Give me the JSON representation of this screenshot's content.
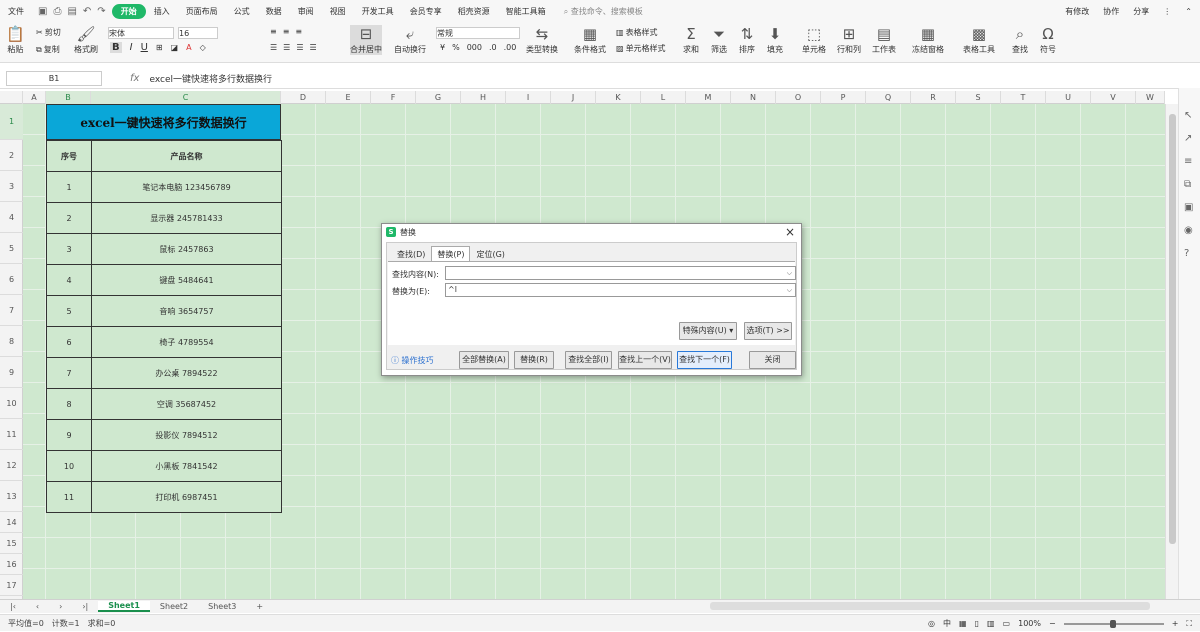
{
  "menubar": {
    "file": "文件",
    "tabs": [
      "开始",
      "插入",
      "页面布局",
      "公式",
      "数据",
      "审阅",
      "视图",
      "开发工具",
      "会员专享",
      "稻壳资源",
      "智能工具箱"
    ],
    "search": "查找命令、搜索模板",
    "right": [
      "有修改",
      "协作",
      "分享"
    ]
  },
  "ribbon": {
    "paste": "粘贴",
    "cut": "剪切",
    "copy": "复制",
    "format_painter": "格式刷",
    "font": "宋体",
    "font_size": "16",
    "bold": "B",
    "italic": "I",
    "underline": "U",
    "merge": "合并居中",
    "wrap": "自动换行",
    "number_format": "常规",
    "currency": "¥",
    "percent": "%",
    "type_convert": "类型转换",
    "cond_format": "条件格式",
    "table_style": "表格样式",
    "cell_style": "单元格样式",
    "sum": "求和",
    "filter": "筛选",
    "sort": "排序",
    "fill": "填充",
    "cell": "单元格",
    "rowcol": "行和列",
    "worksheet": "工作表",
    "freeze": "冻结窗格",
    "table_tools": "表格工具",
    "find": "查找",
    "symbol": "符号"
  },
  "formula_bar": {
    "name_box": "B1",
    "fx": "fx",
    "content": "excel一键快速将多行数据换行"
  },
  "columns": [
    "A",
    "B",
    "C",
    "D",
    "E",
    "F",
    "G",
    "H",
    "I",
    "J",
    "K",
    "L",
    "M",
    "N",
    "O",
    "P",
    "Q",
    "R",
    "S",
    "T",
    "U",
    "V",
    "W"
  ],
  "rows": [
    "1",
    "2",
    "3",
    "4",
    "5",
    "6",
    "7",
    "8",
    "9",
    "10",
    "11",
    "12",
    "13",
    "14",
    "15",
    "16",
    "17"
  ],
  "sheet": {
    "title": "excel一键快速将多行数据换行",
    "headers": [
      "序号",
      "产品名称"
    ],
    "data": [
      [
        "1",
        "笔记本电脑 123456789"
      ],
      [
        "2",
        "显示器 245781433"
      ],
      [
        "3",
        "鼠标 2457863"
      ],
      [
        "4",
        "键盘 5484641"
      ],
      [
        "5",
        "音响 3654757"
      ],
      [
        "6",
        "椅子 4789554"
      ],
      [
        "7",
        "办公桌 7894522"
      ],
      [
        "8",
        "空调 35687452"
      ],
      [
        "9",
        "投影仪 7894512"
      ],
      [
        "10",
        "小黑板 7841542"
      ],
      [
        "11",
        "打印机 6987451"
      ]
    ]
  },
  "dialog": {
    "title": "替换",
    "tabs": [
      "查找(D)",
      "替换(P)",
      "定位(G)"
    ],
    "find_label": "查找内容(N):",
    "find_value": "",
    "replace_label": "替换为(E):",
    "replace_value": "^l",
    "special": "特殊内容(U) ▾",
    "options": "选项(T) >>",
    "tips": "操作技巧",
    "buttons": [
      "全部替换(A)",
      "替换(R)",
      "查找全部(I)",
      "查找上一个(V)",
      "查找下一个(F)",
      "关闭"
    ]
  },
  "sheet_tabs": [
    "Sheet1",
    "Sheet2",
    "Sheet3"
  ],
  "status": {
    "avg": "平均值=0",
    "count": "计数=1",
    "sum": "求和=0",
    "zoom": "100%"
  },
  "colors": {
    "accent": "#1fb868",
    "title_fill": "#0aa7d8",
    "sheet_bg": "#cfe8cf"
  }
}
